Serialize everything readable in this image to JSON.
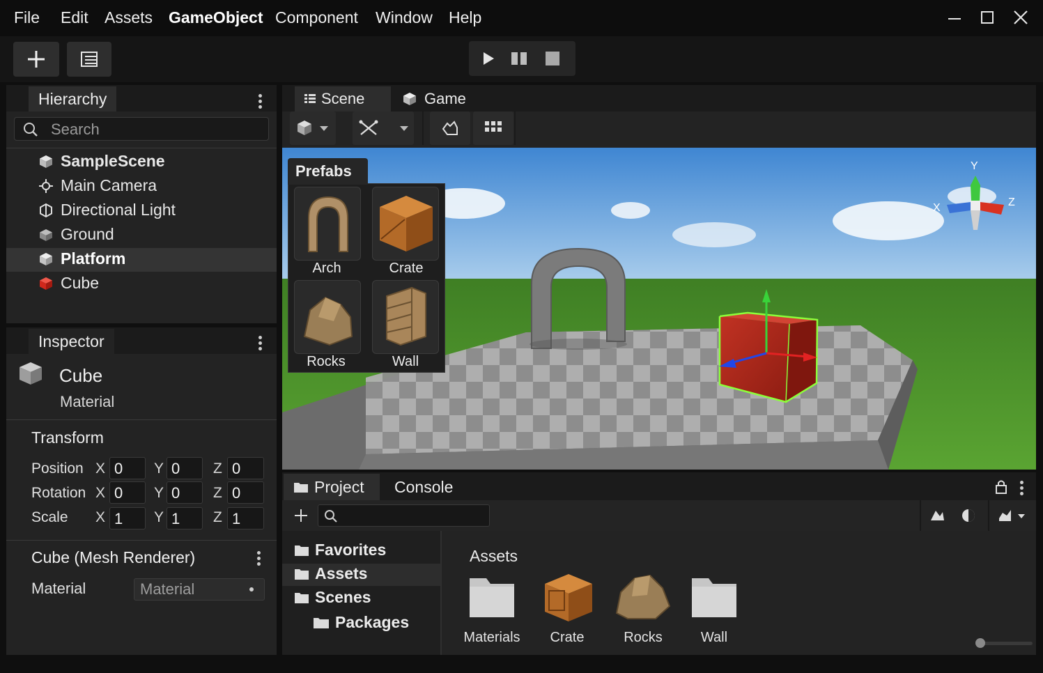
{
  "menu": {
    "items": [
      "File",
      "Edit",
      "Assets",
      "GameObject",
      "Component",
      "Window",
      "Help"
    ]
  },
  "window_controls": {
    "minimize_icon": "minimize-icon",
    "maximize_icon": "maximize-icon",
    "close_icon": "close-icon"
  },
  "toolbar": {
    "add_icon": "plus-icon",
    "layout_icon": "layout-icon",
    "play_icon": "play-icon",
    "pause_icon": "pause-icon",
    "stop_icon": "stop-icon"
  },
  "hierarchy": {
    "tab_label": "Hierarchy",
    "search_placeholder": "Search",
    "items": [
      {
        "label": "SampleScene",
        "icon": "scene-icon",
        "bold": true
      },
      {
        "label": "Main Camera",
        "icon": "camera-icon"
      },
      {
        "label": "Directional Light",
        "icon": "light-icon"
      },
      {
        "label": "Ground",
        "icon": "cube-icon"
      },
      {
        "label": "Platform",
        "icon": "cube-icon",
        "selected": true
      },
      {
        "label": "Cube",
        "icon": "red-cube-icon"
      }
    ]
  },
  "inspector": {
    "tab_label": "Inspector",
    "object_name": "Cube",
    "object_subtitle": "Material",
    "transform": {
      "title": "Transform",
      "position_label": "Position",
      "rotation_label": "Rotation",
      "scale_label": "Scale",
      "x": "X",
      "y": "Y",
      "z": "Z",
      "position": [
        "0",
        "0",
        "0"
      ],
      "rotation": [
        "0",
        "0",
        "0"
      ],
      "scale": [
        "1",
        "1",
        "1"
      ]
    },
    "mesh_renderer": {
      "title": "Cube (Mesh Renderer)",
      "material_label": "Material",
      "material_value": "Material"
    }
  },
  "scene": {
    "tabs": [
      "Scene",
      "Game"
    ],
    "gizmo_labels": {
      "x": "X",
      "y": "Y",
      "z": "Z"
    },
    "colors": {
      "sky_top": "#4a8fd6",
      "grass": "#4c8f2a",
      "selected_cube": "#b0281c",
      "outline": "#7dff3a"
    }
  },
  "prefabs": {
    "title": "Prefabs",
    "items": [
      "Arch",
      "Crate",
      "Rocks",
      "Wall"
    ]
  },
  "project": {
    "tabs": [
      "Project",
      "Console"
    ],
    "folders": [
      {
        "label": "Favorites"
      },
      {
        "label": "Assets",
        "selected": true
      },
      {
        "label": "Scenes"
      },
      {
        "label": "Packages",
        "indent": true
      }
    ],
    "assets_heading": "Assets",
    "assets": [
      "Materials",
      "Crate",
      "Rocks",
      "Wall"
    ]
  }
}
